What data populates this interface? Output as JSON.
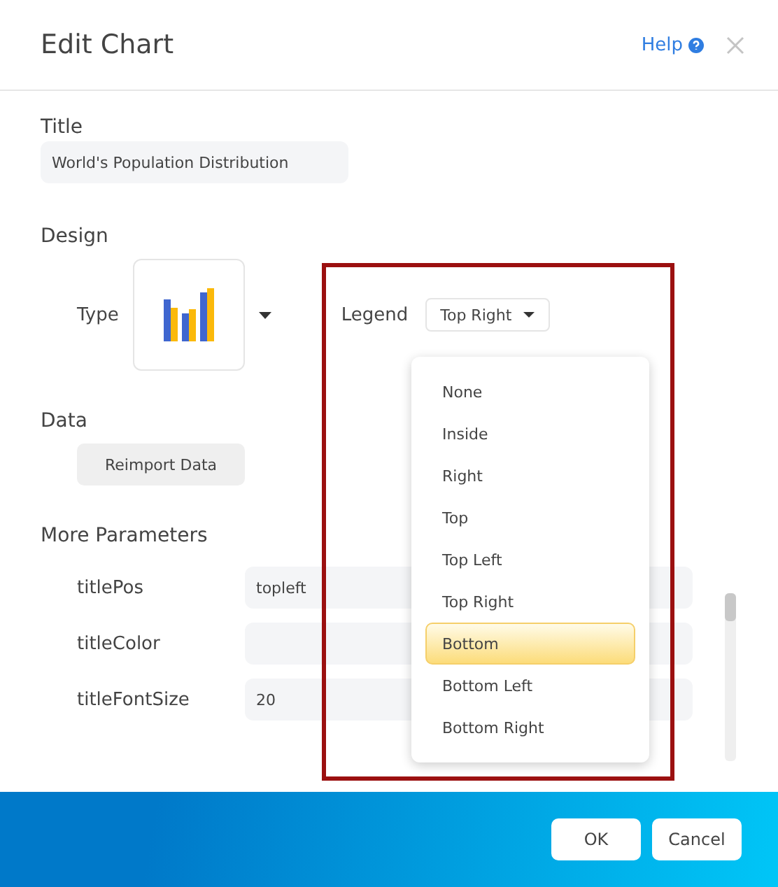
{
  "dialog": {
    "title": "Edit Chart",
    "help": "Help"
  },
  "title_section": {
    "heading": "Title",
    "value": "World's Population Distribution"
  },
  "design": {
    "heading": "Design",
    "type_label": "Type",
    "legend_label": "Legend",
    "legend_value": "Top Right",
    "legend_options": [
      {
        "label": "None",
        "selected": false
      },
      {
        "label": "Inside",
        "selected": false
      },
      {
        "label": "Right",
        "selected": false
      },
      {
        "label": "Top",
        "selected": false
      },
      {
        "label": "Top Left",
        "selected": false
      },
      {
        "label": "Top Right",
        "selected": false
      },
      {
        "label": "Bottom",
        "selected": true
      },
      {
        "label": "Bottom Left",
        "selected": false
      },
      {
        "label": "Bottom Right",
        "selected": false
      }
    ]
  },
  "data": {
    "heading": "Data",
    "button": "Reimport Data"
  },
  "parameters": {
    "heading": "More Parameters",
    "rows": [
      {
        "name": "titlePos",
        "value": "topleft"
      },
      {
        "name": "titleColor"
      },
      {
        "name": "titleFontSize",
        "value": "20"
      }
    ]
  },
  "annotation": {
    "kind": "highlight-frame"
  },
  "buttons": [
    "OK",
    "Cancel"
  ]
}
